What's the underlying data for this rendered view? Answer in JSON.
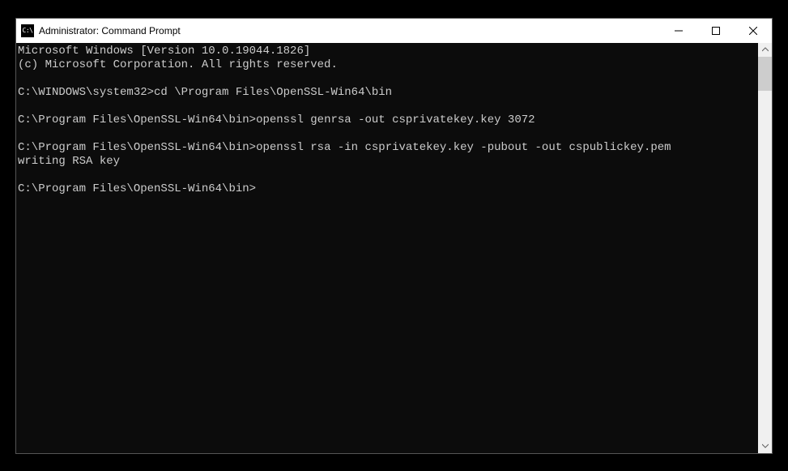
{
  "window": {
    "title": "Administrator: Command Prompt"
  },
  "terminal": {
    "header1": "Microsoft Windows [Version 10.0.19044.1826]",
    "header2": "(c) Microsoft Corporation. All rights reserved.",
    "lines": [
      {
        "prompt": "C:\\WINDOWS\\system32>",
        "command": "cd \\Program Files\\OpenSSL-Win64\\bin"
      },
      {
        "prompt": "C:\\Program Files\\OpenSSL-Win64\\bin>",
        "command": "openssl genrsa -out csprivatekey.key 3072"
      },
      {
        "prompt": "C:\\Program Files\\OpenSSL-Win64\\bin>",
        "command": "openssl rsa -in csprivatekey.key -pubout -out cspublickey.pem"
      }
    ],
    "output1": "writing RSA key",
    "current_prompt": "C:\\Program Files\\OpenSSL-Win64\\bin>"
  }
}
